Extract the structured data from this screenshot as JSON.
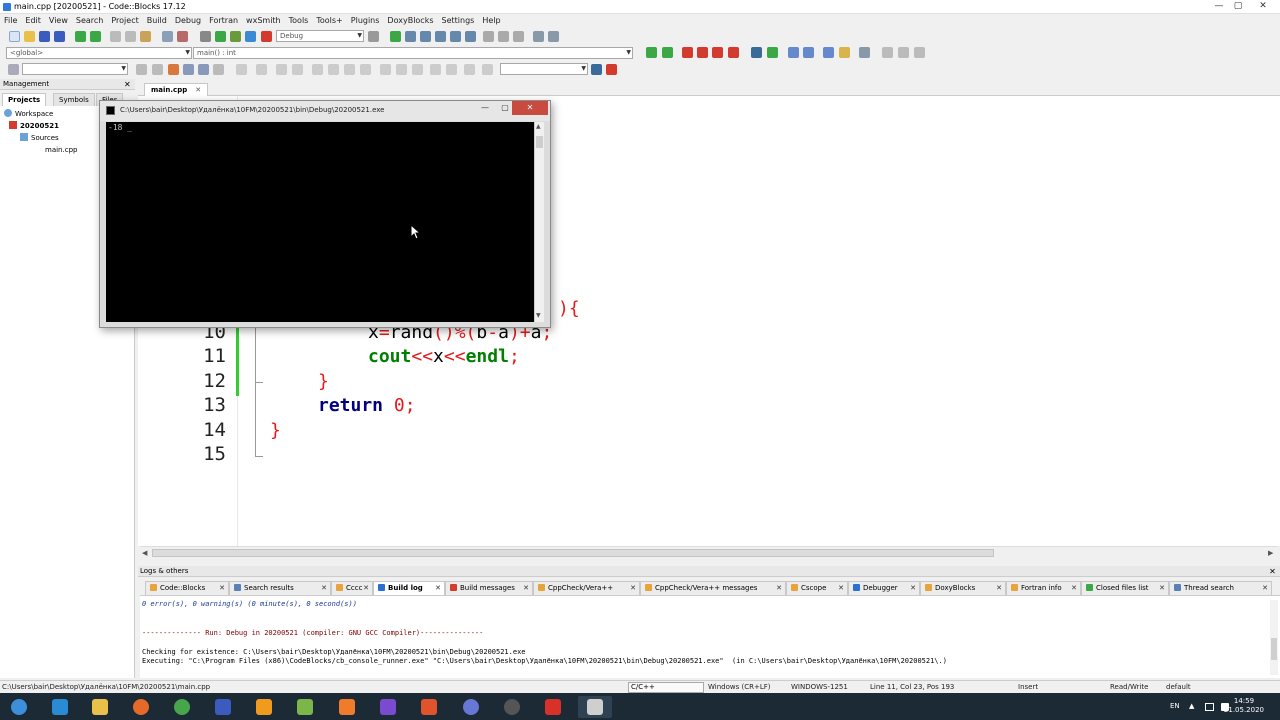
{
  "window": {
    "title": "main.cpp [20200521] - Code::Blocks 17.12",
    "min_glyph": "—",
    "max_glyph": "▢",
    "close_glyph": "✕"
  },
  "menu": [
    "File",
    "Edit",
    "View",
    "Search",
    "Project",
    "Build",
    "Debug",
    "Fortran",
    "wxSmith",
    "Tools",
    "Tools+",
    "Plugins",
    "DoxyBlocks",
    "Settings",
    "Help"
  ],
  "toolbar": {
    "build_target": "Debug",
    "scope_combo": "<global>",
    "function_combo": "main() : int"
  },
  "management": {
    "title": "Management",
    "close": "✕",
    "tabs": [
      "Projects",
      "Symbols",
      "Files"
    ],
    "tree": {
      "workspace": "Workspace",
      "project": "20200521",
      "folder": "Sources",
      "file": "main.cpp"
    }
  },
  "editor": {
    "tab_label": "main.cpp",
    "tab_close": "✕",
    "lines": [
      {
        "n": "10",
        "parts": [
          {
            "c": "tx",
            "t": "x"
          },
          {
            "c": "op",
            "t": "="
          },
          {
            "c": "tx",
            "t": "rand"
          },
          {
            "c": "op",
            "t": "()%("
          },
          {
            "c": "tx",
            "t": "b"
          },
          {
            "c": "op",
            "t": "-"
          },
          {
            "c": "tx",
            "t": "a"
          },
          {
            "c": "op",
            "t": ")+"
          },
          {
            "c": "tx",
            "t": "a"
          },
          {
            "c": "op",
            "t": ";"
          }
        ]
      },
      {
        "n": "11",
        "parts": [
          {
            "c": "fn",
            "t": "cout"
          },
          {
            "c": "op",
            "t": "<<"
          },
          {
            "c": "tx",
            "t": "x"
          },
          {
            "c": "op",
            "t": "<<"
          },
          {
            "c": "fn",
            "t": "endl"
          },
          {
            "c": "op",
            "t": ";"
          }
        ]
      },
      {
        "n": "12",
        "parts": [
          {
            "c": "op",
            "t": "}"
          }
        ]
      },
      {
        "n": "13",
        "parts": [
          {
            "c": "kw",
            "t": "return"
          },
          {
            "c": "tx",
            "t": " "
          },
          {
            "c": "num",
            "t": "0"
          },
          {
            "c": "op",
            "t": ";"
          }
        ]
      },
      {
        "n": "14",
        "parts": [
          {
            "c": "op",
            "t": "}"
          }
        ]
      },
      {
        "n": "15",
        "parts": []
      }
    ],
    "hidden_fragment": "){"
  },
  "console": {
    "title": "C:\\Users\\bair\\Desktop\\Удалёнка\\10FM\\20200521\\bin\\Debug\\20200521.exe",
    "output": "-18 _"
  },
  "logs": {
    "title": "Logs & others",
    "close": "✕",
    "tabs": [
      {
        "label": "Code::Blocks",
        "color": "#e8a33a",
        "active": false
      },
      {
        "label": "Search results",
        "color": "#5b7fb8",
        "active": false
      },
      {
        "label": "Cccc",
        "color": "#e8a33a",
        "active": false
      },
      {
        "label": "Build log",
        "color": "#2a6fd6",
        "active": true
      },
      {
        "label": "Build messages",
        "color": "#d23b2e",
        "active": false
      },
      {
        "label": "CppCheck/Vera++",
        "color": "#e8a33a",
        "active": false
      },
      {
        "label": "CppCheck/Vera++ messages",
        "color": "#e8a33a",
        "active": false
      },
      {
        "label": "Cscope",
        "color": "#e8a33a",
        "active": false
      },
      {
        "label": "Debugger",
        "color": "#2a6fd6",
        "active": false
      },
      {
        "label": "DoxyBlocks",
        "color": "#e8a33a",
        "active": false
      },
      {
        "label": "Fortran info",
        "color": "#e8a33a",
        "active": false
      },
      {
        "label": "Closed files list",
        "color": "#3aa845",
        "active": false
      },
      {
        "label": "Thread search",
        "color": "#5b7fb8",
        "active": false
      }
    ],
    "lines": [
      {
        "cls": "i",
        "t": "0 error(s), 0 warning(s) (0 minute(s), 0 second(s))"
      },
      {
        "cls": "",
        "t": " "
      },
      {
        "cls": "",
        "t": " "
      },
      {
        "cls": "r",
        "t": "-------------- Run: Debug in 20200521 (compiler: GNU GCC Compiler)---------------"
      },
      {
        "cls": "",
        "t": " "
      },
      {
        "cls": "",
        "t": "Checking for existence: C:\\Users\\bair\\Desktop\\Удалёнка\\10FM\\20200521\\bin\\Debug\\20200521.exe"
      },
      {
        "cls": "",
        "t": "Executing: \"C:\\Program Files (x86)\\CodeBlocks/cb_console_runner.exe\" \"C:\\Users\\bair\\Desktop\\Удалёнка\\10FM\\20200521\\bin\\Debug\\20200521.exe\"  (in C:\\Users\\bair\\Desktop\\Удалёнка\\10FM\\20200521\\.)"
      }
    ]
  },
  "status": {
    "path": "C:\\Users\\bair\\Desktop\\Удалёнка\\10FM\\20200521\\main.cpp",
    "lang": "C/C++",
    "eol": "Windows (CR+LF)",
    "encoding": "WINDOWS-1251",
    "position": "Line 11, Col 23, Pos 193",
    "mode": "Insert",
    "access": "Read/Write",
    "profile": "default"
  },
  "taskbar": {
    "lang": "EN",
    "time": "14:59",
    "date": "21.05.2020",
    "tray_up": "▲",
    "apps": [
      {
        "name": "start",
        "color": "#3d8fd9"
      },
      {
        "name": "internet-explorer",
        "color": "#2a8ad4"
      },
      {
        "name": "file-explorer",
        "color": "#e9c14a"
      },
      {
        "name": "firefox",
        "color": "#e56a2a"
      },
      {
        "name": "chrome",
        "color": "#48a64a"
      },
      {
        "name": "app-floppy",
        "color": "#3b5bbf"
      },
      {
        "name": "sublime",
        "color": "#f09a1e"
      },
      {
        "name": "codeblocks",
        "color": "#7ab648"
      },
      {
        "name": "xampp",
        "color": "#f07b2a"
      },
      {
        "name": "twitch",
        "color": "#7a4ad0"
      },
      {
        "name": "app-orange",
        "color": "#e0532b"
      },
      {
        "name": "discord",
        "color": "#6677d6"
      },
      {
        "name": "obs",
        "color": "#555"
      },
      {
        "name": "app-blocks",
        "color": "#d8312a"
      },
      {
        "name": "console-window",
        "color": "#cfcfcf"
      }
    ]
  }
}
